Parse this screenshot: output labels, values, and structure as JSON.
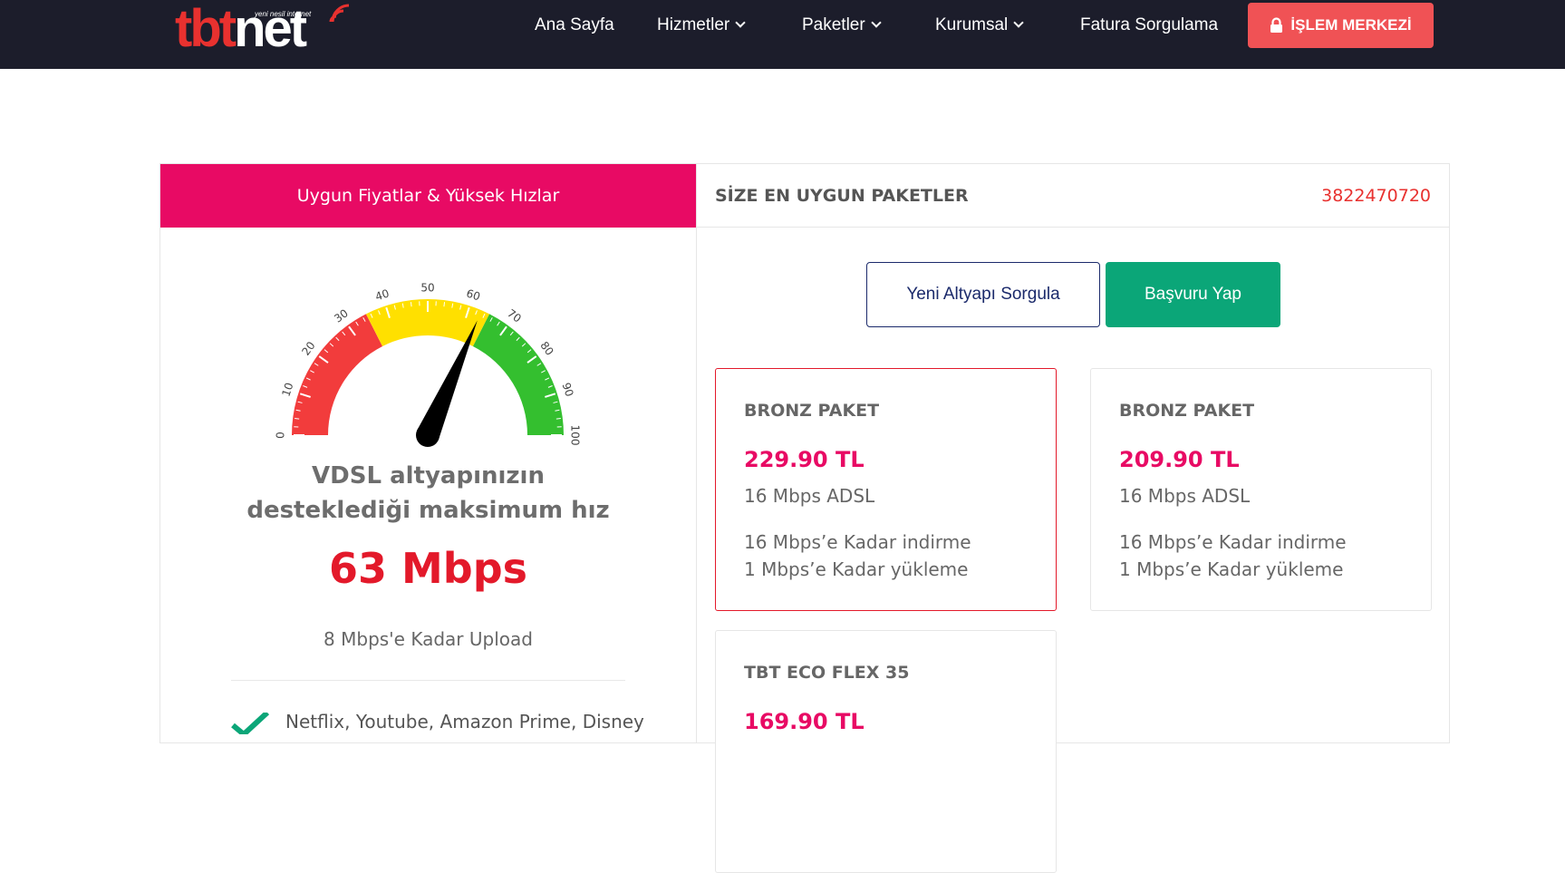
{
  "header": {
    "logo": {
      "text_primary": "tbt",
      "text_secondary": "net",
      "tagline": "yeni nesil internet"
    },
    "nav": [
      {
        "label": "Ana Sayfa",
        "has_dropdown": false
      },
      {
        "label": "Hizmetler",
        "has_dropdown": true
      },
      {
        "label": "Paketler",
        "has_dropdown": true
      },
      {
        "label": "Kurumsal",
        "has_dropdown": true
      },
      {
        "label": "Fatura Sorgulama",
        "has_dropdown": false
      }
    ],
    "cta_label": "İŞLEM MERKEZİ",
    "cta_icon": "lock-icon"
  },
  "left_panel": {
    "header": "Uygun Fiyatlar & Yüksek Hızlar",
    "gauge": {
      "value": 63,
      "min": 0,
      "max": 100,
      "ticks": [
        "0",
        "10",
        "20",
        "30",
        "40",
        "50",
        "60",
        "70",
        "80",
        "90",
        "100"
      ],
      "zones": [
        {
          "from": 0,
          "to": 35,
          "color": "#f23c3c"
        },
        {
          "from": 35,
          "to": 65,
          "color": "#ffe000"
        },
        {
          "from": 65,
          "to": 100,
          "color": "#34bf2f"
        }
      ]
    },
    "title": "VDSL altyapınızın desteklediği maksimum hız",
    "speed": "63 Mbps",
    "upload": "8 Mbps'e Kadar Upload",
    "features": [
      {
        "icon": "check-icon",
        "text": "Netflix, Youtube, Amazon Prime, Disney"
      }
    ]
  },
  "right_panel": {
    "header": "SİZE EN UYGUN PAKETLER",
    "phone": "3822470720",
    "buttons": {
      "query": "Yeni Altyapı Sorgula",
      "apply": "Başvuru Yap"
    },
    "packages": [
      {
        "name": "BRONZ PAKET",
        "price": "229.90 TL",
        "plan": "16 Mbps ADSL",
        "download": "16 Mbps’e Kadar indirme",
        "upload": "1 Mbps’e Kadar yükleme",
        "selected": true
      },
      {
        "name": "BRONZ PAKET",
        "price": "209.90 TL",
        "plan": "16 Mbps ADSL",
        "download": "16 Mbps’e Kadar indirme",
        "upload": "1 Mbps’e Kadar yükleme",
        "selected": false
      },
      {
        "name": "TBT ECO FLEX 35",
        "price": "169.90 TL",
        "plan": "",
        "download": "",
        "upload": "",
        "selected": false
      }
    ]
  },
  "colors": {
    "nav_bg": "#1c1d2b",
    "cta": "#f05255",
    "brand_pink": "#e80a64",
    "speed_red": "#e3192a",
    "green": "#0ba678"
  }
}
